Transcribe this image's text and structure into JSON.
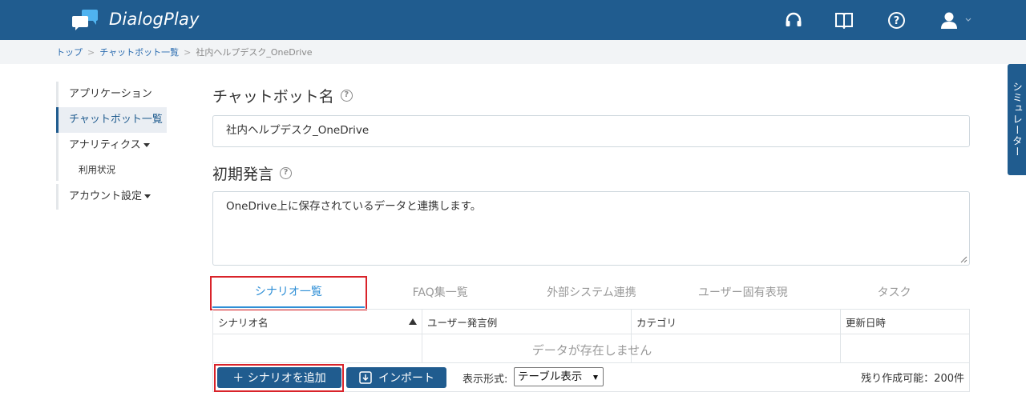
{
  "app": {
    "brand": "DialogPlay"
  },
  "header": {
    "icons": [
      "headset-icon",
      "book-icon",
      "help-icon",
      "user-icon"
    ]
  },
  "breadcrumb": {
    "items": [
      "トップ",
      "チャットボット一覧",
      "社内ヘルプデスク_OneDrive"
    ]
  },
  "sidebar": {
    "items": [
      {
        "label": "アプリケーション"
      },
      {
        "label": "チャットボット一覧"
      },
      {
        "label": "アナリティクス"
      },
      {
        "label": "利用状況"
      },
      {
        "label": "アカウント設定"
      }
    ]
  },
  "form": {
    "name_label": "チャットボット名",
    "name_value": "社内ヘルプデスク_OneDrive",
    "greeting_label": "初期発言",
    "greeting_value": "OneDrive上に保存されているデータと連携します。"
  },
  "tabs": [
    "シナリオ一覧",
    "FAQ集一覧",
    "外部システム連携",
    "ユーザー固有表現",
    "タスク"
  ],
  "table": {
    "columns": [
      "シナリオ名",
      "ユーザー発言例",
      "カテゴリ",
      "更新日時"
    ],
    "empty_text": "データが存在しません"
  },
  "footer": {
    "add_button": "＋ シナリオを追加",
    "import_button": "インポート",
    "display_label": "表示形式:",
    "display_value": "テーブル表示",
    "remaining": "残り作成可能：200件"
  },
  "simulator": {
    "label": "シミュレーター"
  },
  "colors": {
    "primary": "#205c8f",
    "accent": "#2f8fd6",
    "highlight": "#d9232a"
  }
}
